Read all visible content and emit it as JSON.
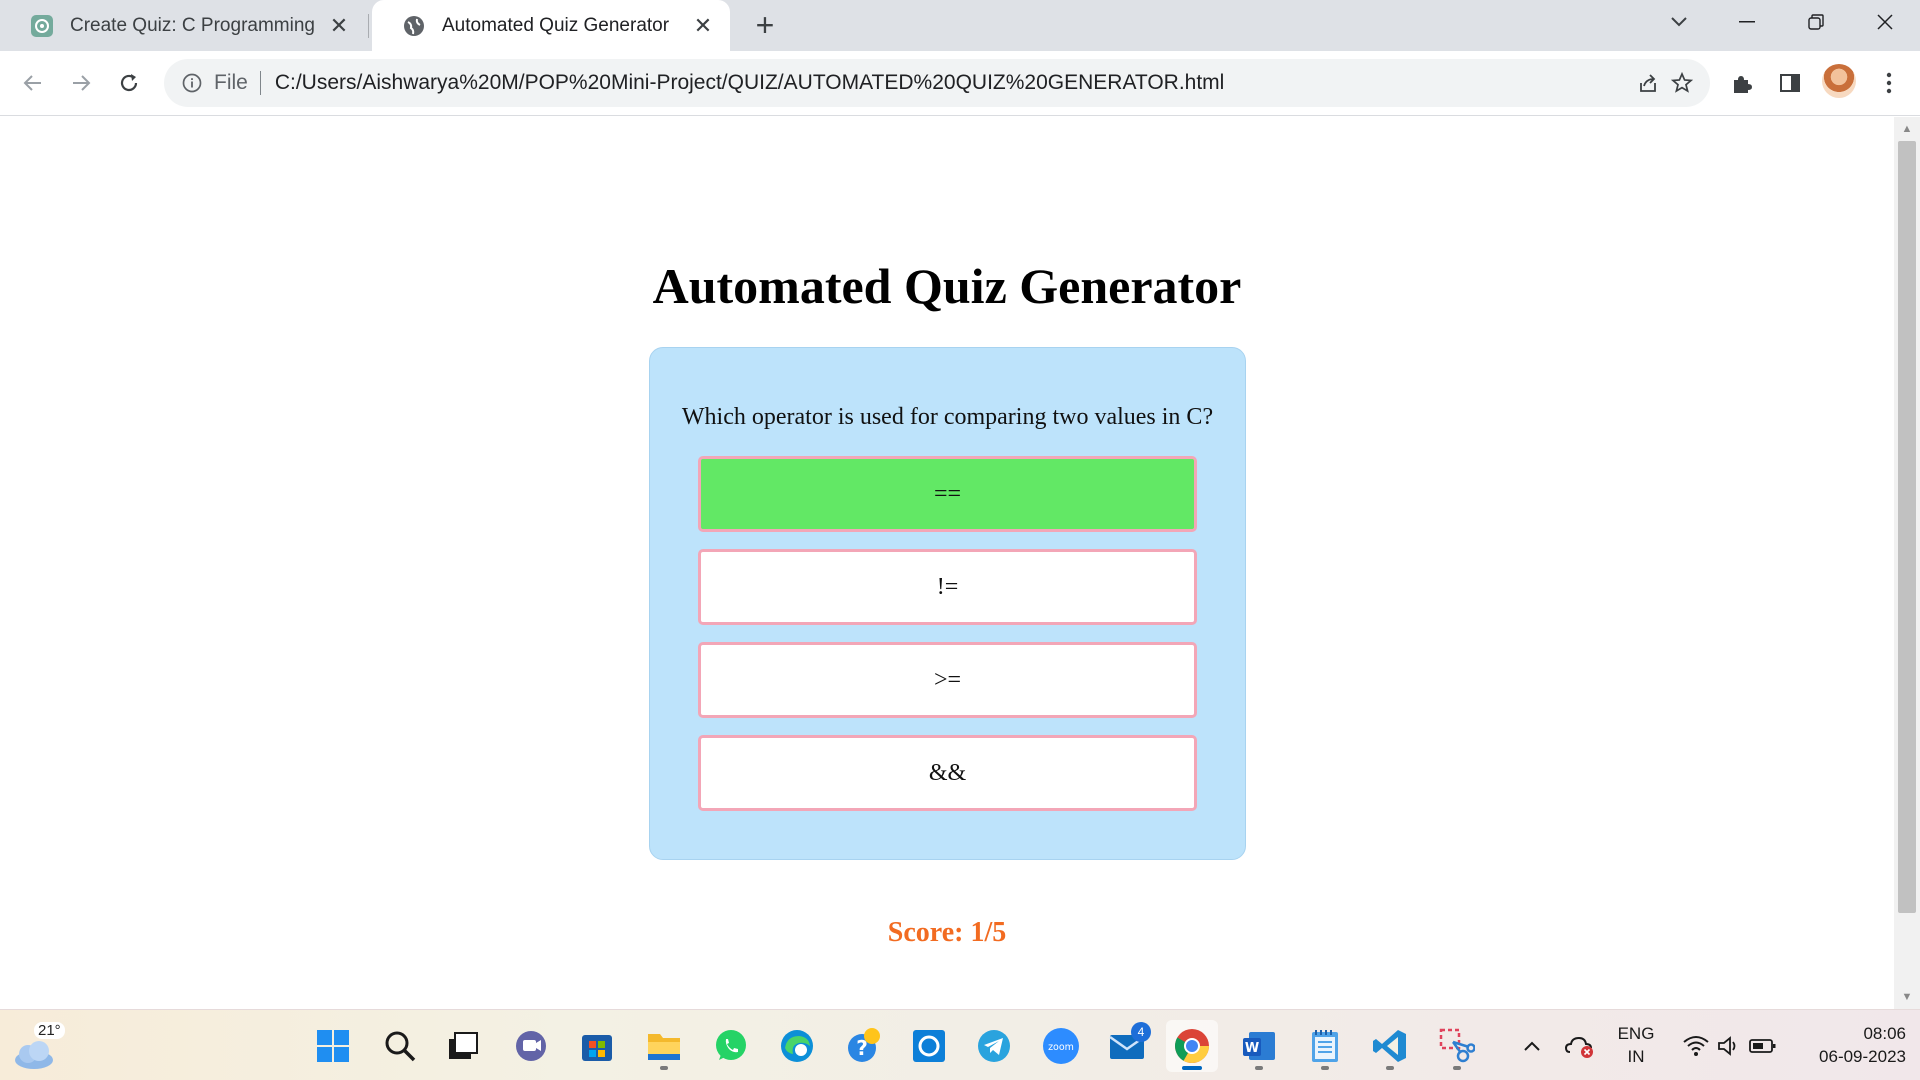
{
  "browser": {
    "tabs": [
      {
        "title": "Create Quiz: C Programming",
        "active": false,
        "favicon": "chatgpt-icon"
      },
      {
        "title": "Automated Quiz Generator",
        "active": true,
        "favicon": "globe-icon"
      }
    ],
    "address_bar": {
      "scheme_label": "File",
      "url": "C:/Users/Aishwarya%20M/POP%20Mini-Project/QUIZ/AUTOMATED%20QUIZ%20GENERATOR.html"
    }
  },
  "page": {
    "heading": "Automated Quiz Generator",
    "quiz": {
      "question": "Which operator is used for comparing two values in C?",
      "options": [
        "==",
        "!=",
        ">=",
        "&&"
      ],
      "selected_correct_index": 0
    },
    "score": {
      "text": "Score: 1/5",
      "color": "#f26b21"
    }
  },
  "colors": {
    "card_bg": "#bde3fb",
    "option_border": "#f3a6b7",
    "correct_bg": "#62e865"
  },
  "taskbar": {
    "weather_temp": "21°",
    "pinned": [
      "windows-start-icon",
      "search-icon",
      "task-view-icon",
      "teams-chat-icon",
      "microsoft-store-icon",
      "file-explorer-icon",
      "whatsapp-icon",
      "edge-icon",
      "get-help-icon",
      "cortana-icon",
      "telegram-icon",
      "zoom-icon",
      "mail-icon",
      "chrome-icon",
      "word-icon",
      "notepad-icon",
      "vscode-icon",
      "snipping-tool-icon"
    ],
    "zoom_label": "zoom",
    "word_label": "W",
    "mail_badge": "4",
    "language_line1": "ENG",
    "language_line2": "IN",
    "time": "08:06",
    "date": "06-09-2023"
  }
}
